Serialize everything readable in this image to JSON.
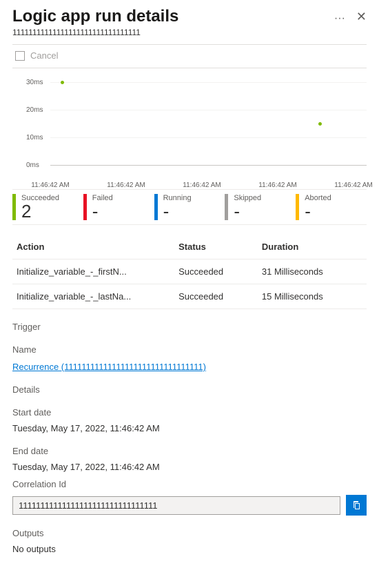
{
  "header": {
    "title": "Logic app run details",
    "subtitle": "11111111111111111111111111111111",
    "dots": "···",
    "close": "✕"
  },
  "toolbar": {
    "cancel_label": "Cancel"
  },
  "chart_data": {
    "type": "scatter",
    "ylabel_unit": "ms",
    "y_ticks": [
      0,
      10,
      20,
      30
    ],
    "y_tick_labels": [
      "0ms",
      "10ms",
      "20ms",
      "30ms"
    ],
    "x_tick_labels": [
      "11:46:42 AM",
      "11:46:42 AM",
      "11:46:42 AM",
      "11:46:42 AM",
      "11:46:42 AM"
    ],
    "series": [
      {
        "name": "Succeeded",
        "color": "#7fba00",
        "points": [
          {
            "x_index": 0.15,
            "y": 31
          },
          {
            "x_index": 3.55,
            "y": 15
          }
        ]
      }
    ]
  },
  "status_summary": [
    {
      "label": "Succeeded",
      "value": "2",
      "color": "#7fba00"
    },
    {
      "label": "Failed",
      "value": "-",
      "color": "#e81123"
    },
    {
      "label": "Running",
      "value": "-",
      "color": "#0078d4"
    },
    {
      "label": "Skipped",
      "value": "-",
      "color": "#a19f9d"
    },
    {
      "label": "Aborted",
      "value": "-",
      "color": "#ffb900"
    }
  ],
  "table": {
    "headers": {
      "action": "Action",
      "status": "Status",
      "duration": "Duration"
    },
    "rows": [
      {
        "action": "Initialize_variable_-_firstN...",
        "status": "Succeeded",
        "duration": "31 Milliseconds"
      },
      {
        "action": "Initialize_variable_-_lastNa...",
        "status": "Succeeded",
        "duration": "15 Milliseconds"
      }
    ]
  },
  "trigger": {
    "section_label": "Trigger",
    "name_label": "Name",
    "link_text": "Recurrence (11111111111111111111111111111111)"
  },
  "details": {
    "section_label": "Details",
    "start_label": "Start date",
    "start_value": "Tuesday, May 17, 2022, 11:46:42 AM",
    "end_label": "End date",
    "end_value": "Tuesday, May 17, 2022, 11:46:42 AM",
    "corr_label": "Correlation Id",
    "corr_value": "11111111111111111111111111111111"
  },
  "outputs": {
    "section_label": "Outputs",
    "value": "No outputs"
  }
}
